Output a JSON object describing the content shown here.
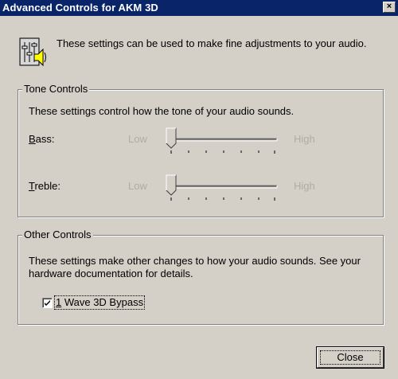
{
  "window": {
    "title": "Advanced Controls for AKM 3D",
    "close_glyph": "×"
  },
  "header": {
    "icon": "audio-settings-speaker-icon",
    "description": "These settings can be used to make fine adjustments to your audio."
  },
  "tone_controls": {
    "group_label": "Tone Controls",
    "description": "These settings control how the tone of your audio sounds.",
    "bass": {
      "label_accel": "B",
      "label_rest": "ass:",
      "low": "Low",
      "high": "High",
      "value": 0,
      "ticks": 7,
      "enabled": false
    },
    "treble": {
      "label_accel": "T",
      "label_rest": "reble:",
      "low": "Low",
      "high": "High",
      "value": 0,
      "ticks": 7,
      "enabled": false
    }
  },
  "other_controls": {
    "group_label": "Other Controls",
    "description": "These settings make other changes to how your audio sounds.  See your hardware documentation for details.",
    "checkbox": {
      "label_accel": "1",
      "label_rest": " Wave 3D Bypass",
      "checked": true
    }
  },
  "footer": {
    "close_label": "Close"
  },
  "colors": {
    "titlebar": "#0a246a",
    "face": "#d4d0c8",
    "disabled_text": "#b0aca4"
  }
}
